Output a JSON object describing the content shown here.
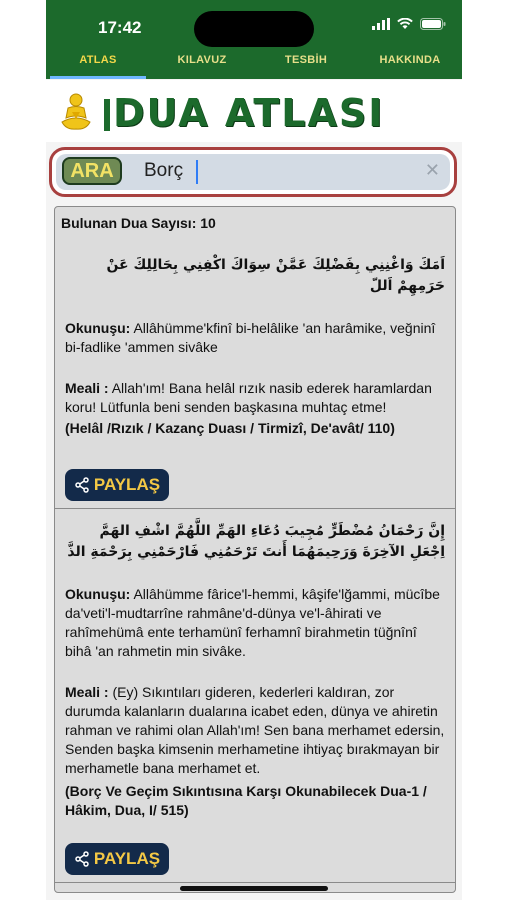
{
  "status": {
    "time": "17:42"
  },
  "tabs": [
    {
      "label": "ATLAS",
      "active": true
    },
    {
      "label": "KILAVUZ",
      "active": false
    },
    {
      "label": "TESBİH",
      "active": false
    },
    {
      "label": "HAKKINDA",
      "active": false
    }
  ],
  "brand": {
    "title": "DUA ATLASI"
  },
  "search": {
    "button": "ARA",
    "value": "Borç"
  },
  "results": {
    "count_label": "Bulunan Dua Sayısı: 10",
    "items": [
      {
        "arabic": "اَمَكَ وَاغْنِنِي بِفَضْلِكَ عَمَّنْ سِوَاكَ اكْفِنِي بِحَالِلِكَ عَنْ حَرَمِهِمْ اَللّ",
        "okunusu_label": "Okunuşu:",
        "okunusu": " Allâhümme'kfinî bi-helâlike 'an harâmike, veğninî bi-fadlike 'ammen sivâke",
        "meali_label": "Meali :",
        "meali": " Allah'ım! Bana helâl rızık nasib ederek haramlardan koru! Lütfunla beni senden başkasına muhtaç etme!",
        "source": "(Helâl /Rızık / Kazanç Duası / Tirmizî, De'avât/ 110)",
        "share": "PAYLAŞ"
      },
      {
        "arabic": "إِنَّ رَحْمَانُ مُضْطَرٍّ مُجِيبَ دُعَاءِ الهَمِّ اللَّهُمَّ اشْفِ الهَمَّ اِجْعَلِ الآخِرَةَ وَرَحِيمَهُمَا أَنتَ تَرْحَمُنِي فَارْحَمْنِي بِرَحْمَةِ الذَّ",
        "okunusu_label": "Okunuşu:",
        "okunusu": " Allâhümme fârice'l-hemmi, kâşife'lğammi, mücîbe da'veti'l-mudtarrîne rahmâne'd-dünya ve'l-âhirati ve rahîmehümâ ente terhamünî ferhamnî birahmetin tüğnînî bihâ 'an rahmetin min sivâke.",
        "meali_label": "Meali :",
        "meali": " (Ey) Sıkıntıları gideren, kederleri kaldıran, zor durumda kalanların dualarına icabet eden, dünya ve ahiretin rahman ve rahimi olan Allah'ım! Sen bana merhamet edersin, Senden başka kimsenin merhametine ihtiyaç bırakmayan bir merhametle bana merhamet et.",
        "source": "(Borç Ve Geçim Sıkıntısına Karşı Okunabilecek Dua-1 / Hâkim, Dua, I/ 515)",
        "share": "PAYLAŞ"
      }
    ]
  }
}
